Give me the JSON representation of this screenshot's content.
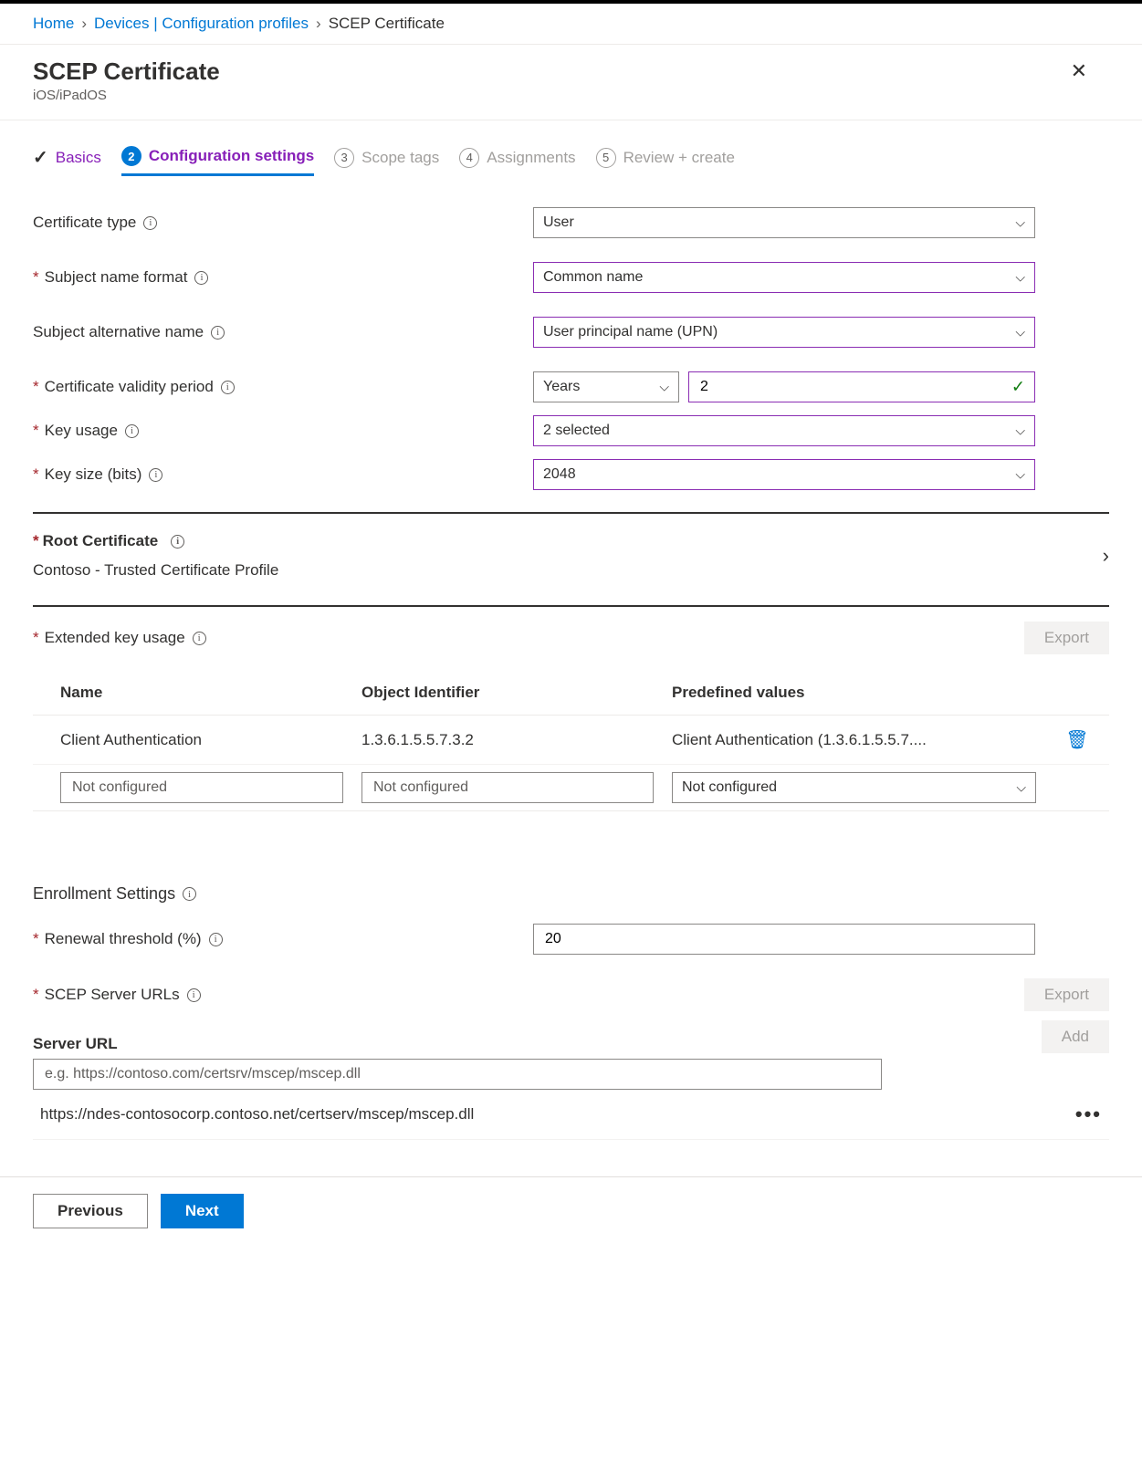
{
  "breadcrumb": {
    "home": "Home",
    "devices": "Devices | Configuration profiles",
    "current": "SCEP Certificate"
  },
  "header": {
    "title": "SCEP Certificate",
    "subtitle": "iOS/iPadOS"
  },
  "tabs": {
    "t1": "Basics",
    "t2_num": "2",
    "t2": "Configuration settings",
    "t3_num": "3",
    "t3": "Scope tags",
    "t4_num": "4",
    "t4": "Assignments",
    "t5_num": "5",
    "t5": "Review + create"
  },
  "labels": {
    "cert_type": "Certificate type",
    "subject_name_format": "Subject name format",
    "san": "Subject alternative name",
    "validity": "Certificate validity period",
    "key_usage": "Key usage",
    "key_size": "Key size (bits)",
    "root_cert": "Root Certificate",
    "eku": "Extended key usage",
    "enroll": "Enrollment Settings",
    "renewal": "Renewal threshold (%)",
    "scep_urls": "SCEP Server URLs",
    "server_url": "Server URL"
  },
  "values": {
    "cert_type": "User",
    "subject_name_format": "Common name",
    "san": "User principal name (UPN)",
    "validity_unit": "Years",
    "validity_value": "2",
    "key_usage": "2 selected",
    "key_size": "2048",
    "root_cert": "Contoso - Trusted Certificate Profile",
    "renewal": "20",
    "server_url_placeholder": "e.g. https://contoso.com/certsrv/mscep/mscep.dll",
    "server_url_entry": "https://ndes-contosocorp.contoso.net/certserv/mscep/mscep.dll"
  },
  "eku": {
    "header": {
      "name": "Name",
      "oid": "Object Identifier",
      "predef": "Predefined values"
    },
    "row": {
      "name": "Client Authentication",
      "oid": "1.3.6.1.5.5.7.3.2",
      "predef": "Client Authentication (1.3.6.1.5.5.7...."
    },
    "placeholder": "Not configured"
  },
  "buttons": {
    "export": "Export",
    "add": "Add",
    "previous": "Previous",
    "next": "Next"
  }
}
